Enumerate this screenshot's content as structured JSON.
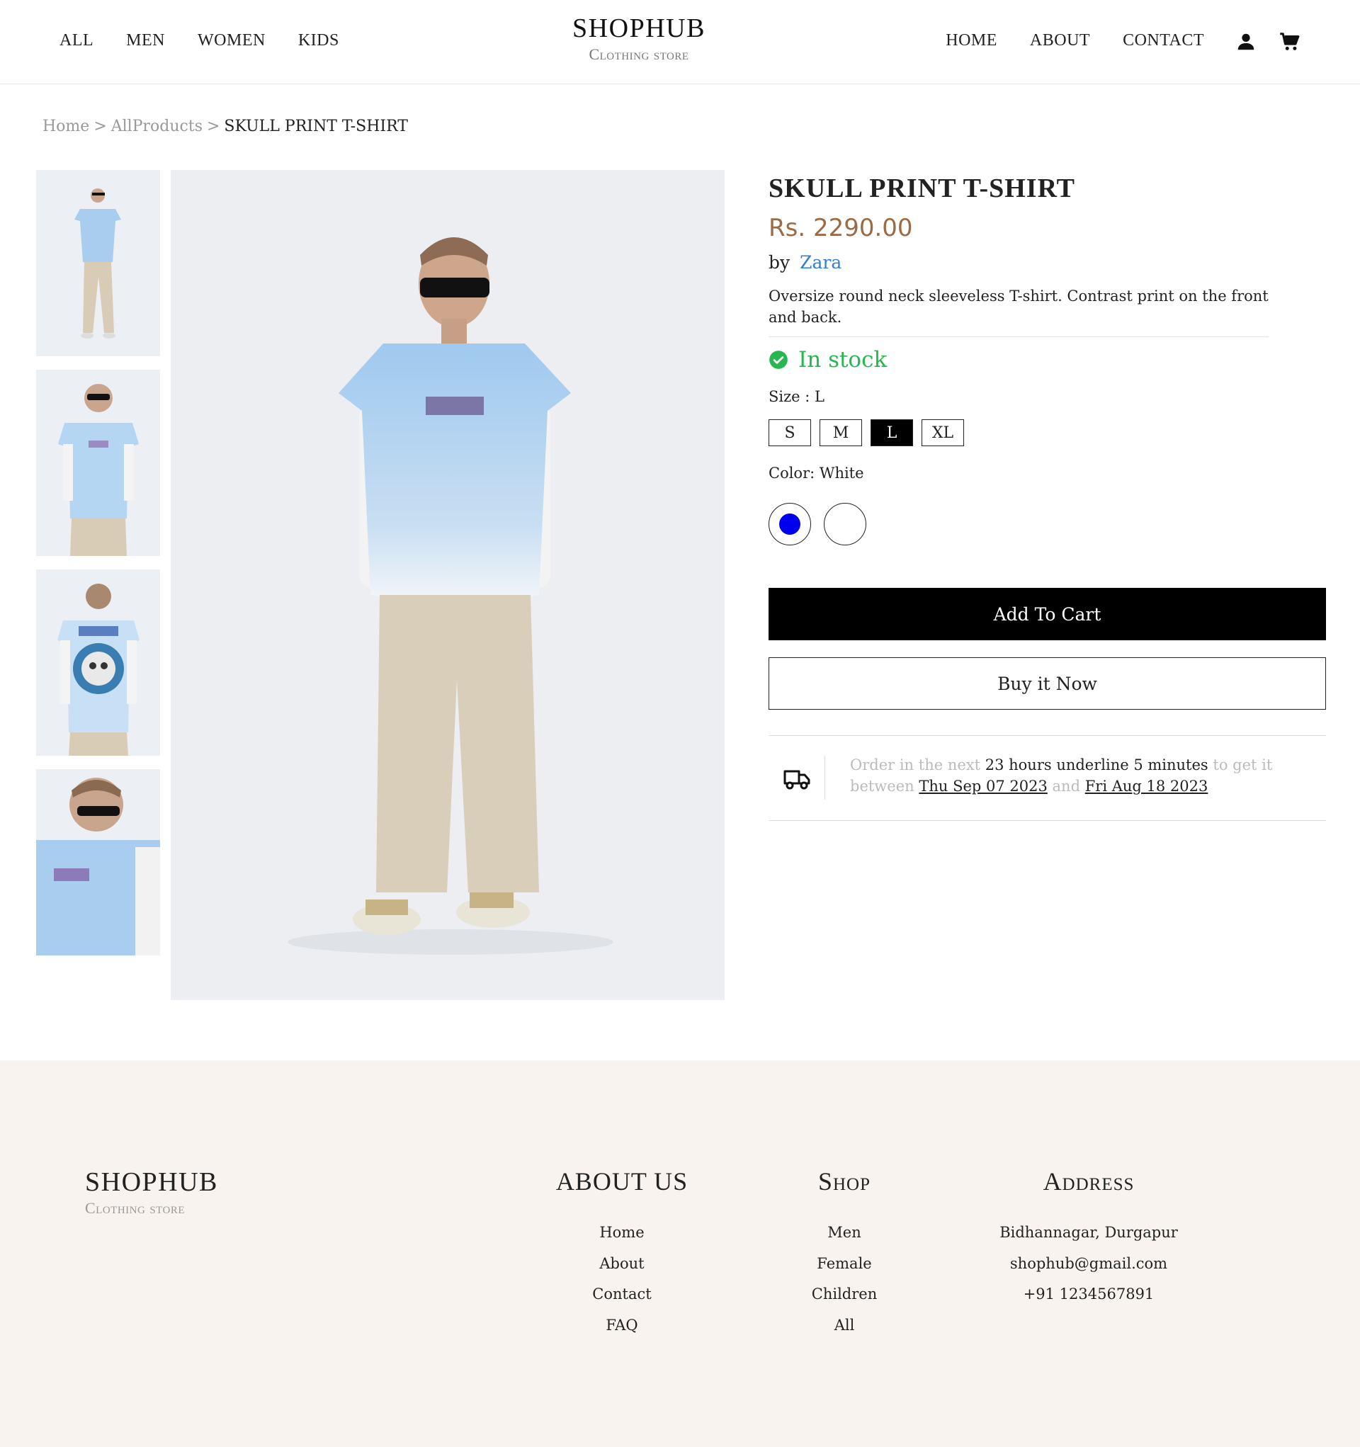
{
  "header": {
    "nav_left": [
      "ALL",
      "MEN",
      "WOMEN",
      "KIDS"
    ],
    "brand_title": "SHOPHUB",
    "brand_subtitle": "Clothing store",
    "nav_right": [
      "HOME",
      "ABOUT",
      "CONTACT"
    ],
    "icons": [
      "user-icon",
      "cart-icon"
    ]
  },
  "breadcrumb": {
    "home": "Home",
    "all_products": "AllProducts",
    "current": "SKULL PRINT T-SHIRT",
    "separator": ">"
  },
  "product": {
    "title": "SKULL PRINT T-SHIRT",
    "price": "Rs. 2290.00",
    "by_label": "by",
    "brand": "Zara",
    "description": "Oversize round neck sleeveless T-shirt. Contrast print on the front and back.",
    "stock_status": "In stock",
    "size_label": "Size : L",
    "sizes": [
      "S",
      "M",
      "L",
      "XL"
    ],
    "selected_size": "L",
    "color_label": "Color: White",
    "colors": [
      "#0000ee",
      "#ffffff"
    ],
    "add_to_cart": "Add To Cart",
    "buy_now": "Buy it Now"
  },
  "delivery": {
    "part1": "Order in the next ",
    "hours": "23 hours underline 5 minutes",
    "part2": " to get it between ",
    "date_from": "Thu Sep 07 2023",
    "and": " and ",
    "date_to": "Fri Aug 18 2023"
  },
  "footer": {
    "brand_title": "SHOPHUB",
    "brand_subtitle": "Clothing store",
    "about": {
      "title": "ABOUT US",
      "items": [
        "Home",
        "About",
        "Contact",
        "FAQ"
      ]
    },
    "shop": {
      "title": "Shop",
      "items": [
        "Men",
        "Female",
        "Children",
        "All"
      ]
    },
    "address": {
      "title": "Address",
      "items": [
        "Bidhannagar, Durgapur",
        "shophub@gmail.com",
        "+91 1234567891"
      ]
    }
  },
  "colors": {
    "price": "#9c6a44",
    "brand_link": "#2f7fd6",
    "in_stock": "#27b64f",
    "footer_bg": "#f8f3ee"
  }
}
